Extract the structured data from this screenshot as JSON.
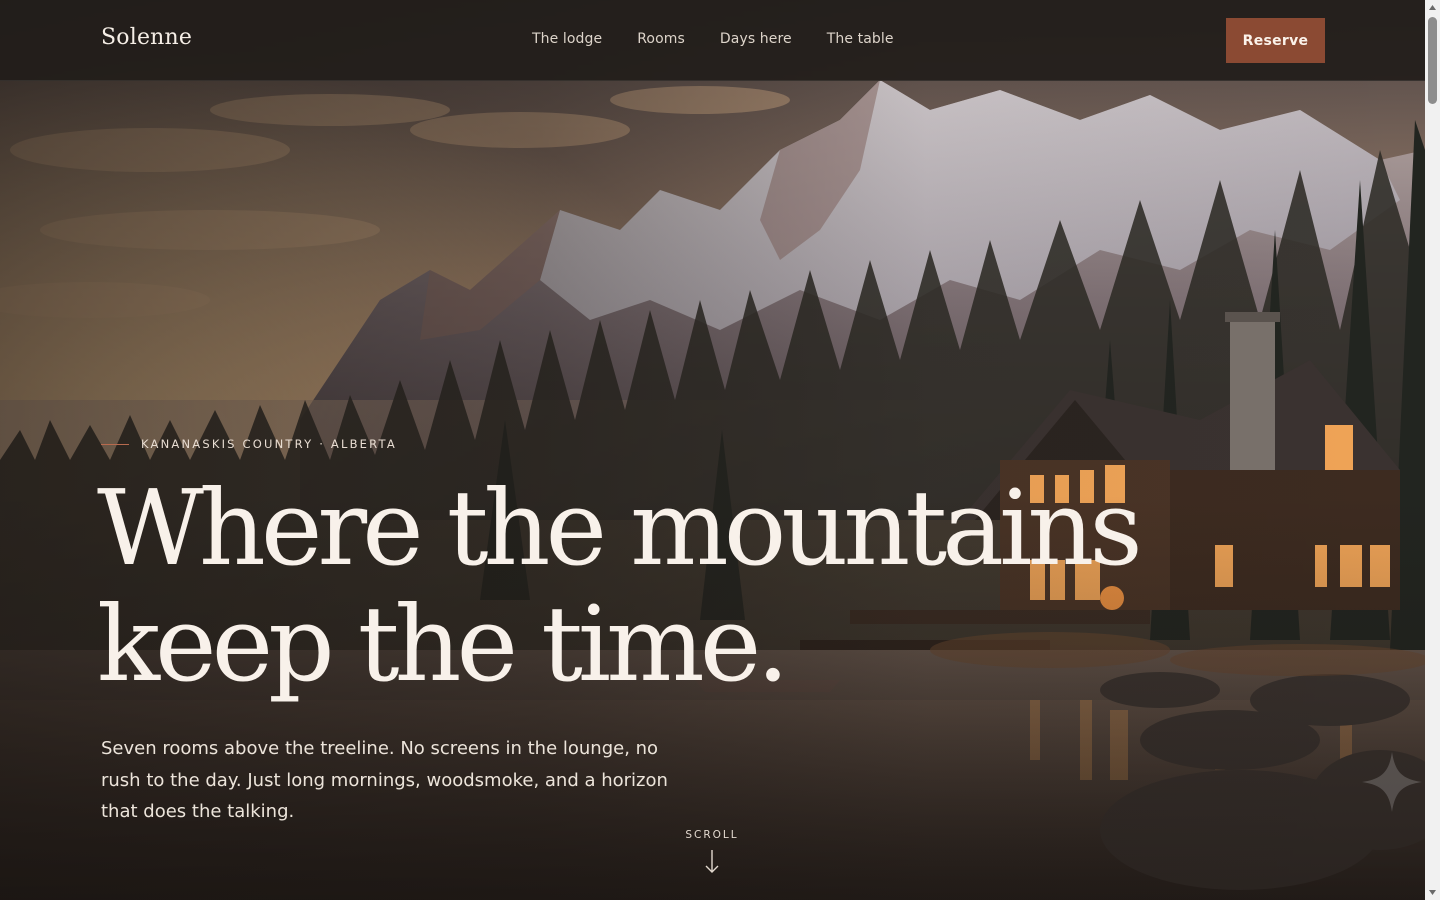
{
  "header": {
    "brand": "Solenne",
    "nav": [
      "The lodge",
      "Rooms",
      "Days here",
      "The table"
    ],
    "cta_label": "Reserve"
  },
  "hero": {
    "eyebrow": "KANANASKIS COUNTRY · ALBERTA",
    "headline_line1": "Where the mountains",
    "headline_line2": "keep the time.",
    "lede": "Seven rooms above the treeline. No screens in the lounge, no rush to the day. Just long mornings, woodsmoke, and a horizon that does the talking.",
    "scroll_label": "SCROLL"
  },
  "icons": {
    "scroll_arrow": "arrow-down-icon",
    "sparkle": "sparkle-icon"
  },
  "colors": {
    "accent": "#8b4a33",
    "headline": "#f8f1ea",
    "header_bg": "#221d1a"
  }
}
